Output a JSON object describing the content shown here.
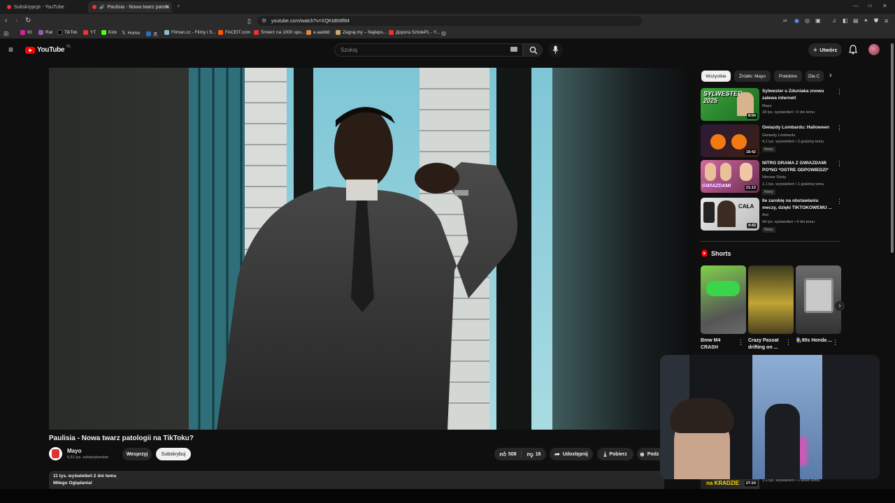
{
  "browser": {
    "tabs": [
      {
        "title": "Subskrypcje - YouTube"
      },
      {
        "title": "Paulisia - Nowa twarz patolo"
      }
    ],
    "url": "youtube.com/watch?v=XQKtd6I8f84",
    "bookmarks": [
      "IG",
      "Rat",
      "TikTok",
      "YT",
      "Kick",
      "Home",
      "天",
      "Filman.cc - Filmy i S...",
      "FACEIT.com",
      "Śmierć na 1000 spo...",
      "a aaddd",
      "Zagraj.my – Najleps...",
      "Дорога SzlolePL - Y..."
    ],
    "shield_count": "4"
  },
  "youtube": {
    "logo": "YouTube",
    "region": "PL",
    "search_placeholder": "Szukaj",
    "create_label": "Utwórz"
  },
  "video": {
    "title": "Paulisia - Nowa twarz patologii na TikToku?",
    "channel": "Mayo",
    "subscribers": "5,61 tys. subskrybentów",
    "support_label": "Wesprzyj",
    "subscribe_label": "Subskrybuj",
    "likes": "508",
    "dislikes": "16",
    "share_label": "Udostępnij",
    "download_label": "Pobierz",
    "thanks_label": "Podz",
    "views_date": "11 tys. wyświetleń  2 dni temu",
    "description": "Miłego Oglądania!"
  },
  "sidebar": {
    "chips": [
      "Wszystkie",
      "Źródło: Mayo",
      "Podobne",
      "Dla C"
    ],
    "recommendations": [
      {
        "title": "Sylwester u Zduniaka znowu zalewa internet!",
        "channel": "Mayo",
        "meta": "18 tys. wyświetleń • 9 dni temu",
        "duration": "8:04",
        "badge": "",
        "thumb_text": "SYLWESTER 2025"
      },
      {
        "title": "Gwiazdy Lombardu: Halloween",
        "channel": "Gwiazdy Lombardu",
        "meta": "4,1 tys. wyświetleń • 2 godziny temu",
        "duration": "18:42",
        "badge": "Nowy",
        "thumb_text": ""
      },
      {
        "title": "NITRO DRAMA Z GWIAZDAMI PO*NO *OSTRE ODPOWIEDZI*",
        "channel": "Nitrowe Shoty",
        "meta": "1,1 tys. wyświetleń • 1 godzinę temu",
        "duration": "21:13",
        "badge": "Nowy",
        "thumb_text": "GWIAZDAMI"
      },
      {
        "title": "Ile zarobię na obstawianiu meczy, dzięki TIKTOKOWEMU ...",
        "channel": "Avir",
        "meta": "44 tys. wyświetleń • 4 dni temu",
        "duration": "4:43",
        "badge": "Nowy",
        "thumb_text": "CAŁA"
      }
    ],
    "shorts_heading": "Shorts",
    "shorts": [
      {
        "title": "Bmw M4 CRASH"
      },
      {
        "title": "Crazy Passat drifting on ..."
      },
      {
        "title": "🧑‍🔧90s Honda ..."
      }
    ],
    "bottom_rec": {
      "thumb_text": "na KRADZIE",
      "duration": "27:24",
      "meta": "1,6 tys. wyświetleń • 1 dzień temu"
    }
  }
}
